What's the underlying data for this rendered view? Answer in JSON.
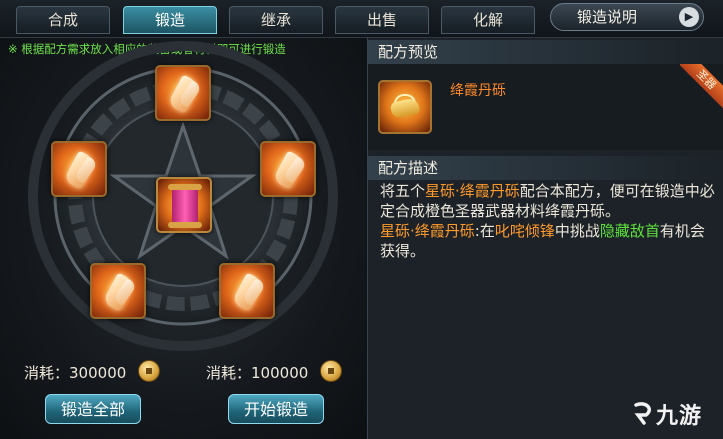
{
  "tabs": [
    {
      "label": "合成",
      "active": false
    },
    {
      "label": "锻造",
      "active": true
    },
    {
      "label": "继承",
      "active": false
    },
    {
      "label": "出售",
      "active": false
    },
    {
      "label": "化解",
      "active": false
    }
  ],
  "help_button": {
    "label": "锻造说明",
    "icon": "play-arrow-icon"
  },
  "forge": {
    "hint": "※ 根据配方需求放入相应的装备或者材料即可进行锻造",
    "center_item": "scroll-icon",
    "slot_item": "crystal-shard-icon",
    "cost_left": {
      "label": "消耗：",
      "value": "300000"
    },
    "cost_right": {
      "label": "消耗：",
      "value": "100000"
    },
    "coin_icon": "coin-icon",
    "forge_all_button": "锻造全部",
    "start_forge_button": "开始锻造"
  },
  "recipe_preview": {
    "title": "配方预览",
    "item_name": "绛霞丹砾",
    "badge": "圣器"
  },
  "recipe_desc": {
    "title": "配方描述",
    "p1_a": "将五个",
    "p1_b": "星砾·绛霞丹砾",
    "p1_c": "配合本配方，便可在锻造中必定合成橙色圣器武器材料绛霞丹砾。",
    "p2_a": "星砾·绛霞丹砾",
    "p2_b": ":在",
    "p2_c": "叱咤倾锋",
    "p2_d": "中挑战",
    "p2_e": "隐藏敌首",
    "p2_f": "有机会获得。"
  },
  "watermark": "九游",
  "colors": {
    "accent_tab": "#3a8ea3",
    "item_name": "#ff8a2a",
    "highlight_green": "#5ee23c",
    "hint_green": "#6fe34a"
  }
}
